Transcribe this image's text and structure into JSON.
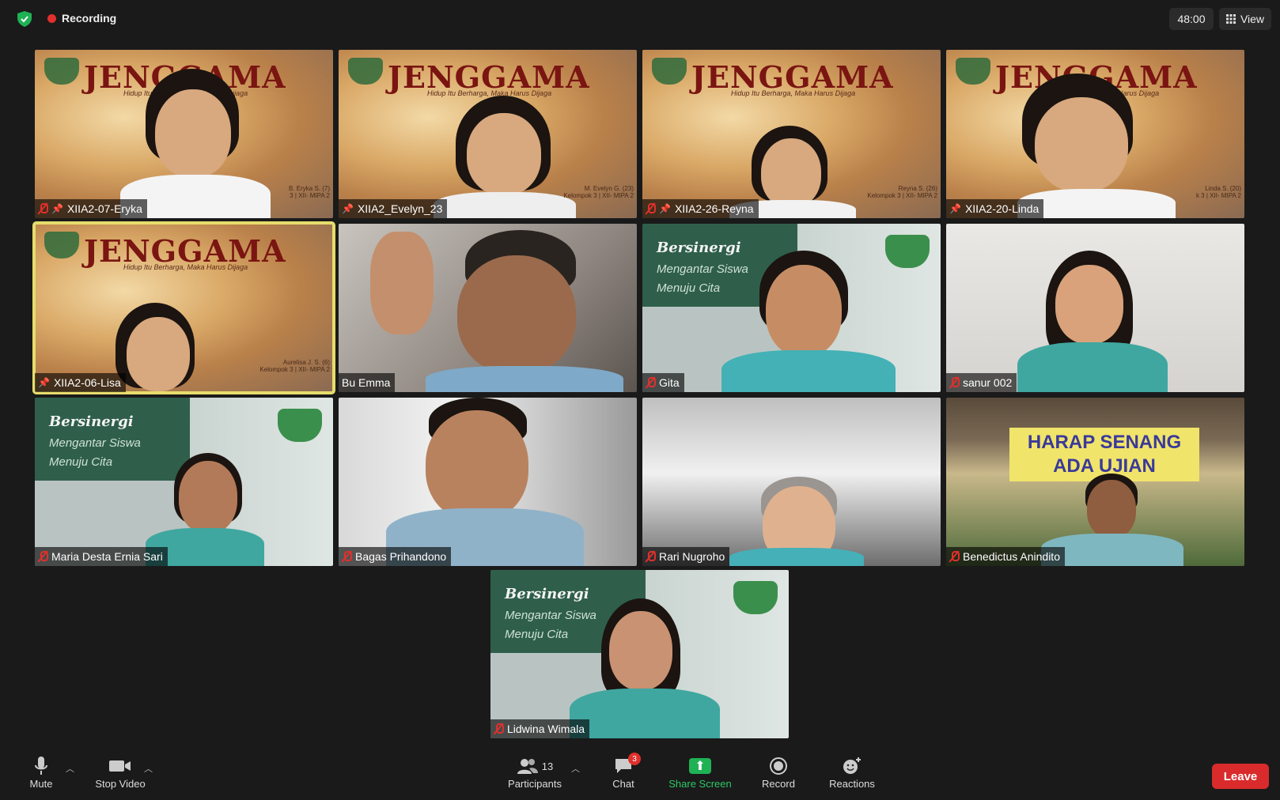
{
  "top": {
    "recording_label": "Recording",
    "timer": "48:00",
    "view_label": "View"
  },
  "jenggama": {
    "title": "JENGGAMA",
    "subtitle": "Hidup Itu Berharga, Maka Harus Dijaga"
  },
  "bersinergi": {
    "title": "Bersinergi",
    "line1": "Mengantar Siswa",
    "line2": "Menuju Cita"
  },
  "banner": {
    "line1": "HARAP SENANG",
    "line2": "ADA UJIAN"
  },
  "tiles": [
    {
      "name": "XIIA2-07-Eryka",
      "note1": "B. Eryka S. (7)",
      "note2": "3 | XII- MIPA 2"
    },
    {
      "name": "XIIA2_Evelyn_23",
      "note1": "M. Evelyn G. (23)",
      "note2": "Kelompok 3 | XII- MIPA 2"
    },
    {
      "name": "XIIA2-26-Reyna",
      "note1": "Reyna S. (26)",
      "note2": "Kelompok 3 | XII- MIPA 2"
    },
    {
      "name": "XIIA2-20-Linda",
      "note1": "Linda S. (20)",
      "note2": "k 3 | XII- MIPA 2"
    },
    {
      "name": "XIIA2-06-Lisa",
      "note1": "Aurelisa J. S. (6)",
      "note2": "Kelompok 3 | XII- MIPA 2"
    },
    {
      "name": "Bu Emma"
    },
    {
      "name": "Gita"
    },
    {
      "name": "sanur 002"
    },
    {
      "name": "Maria Desta Ernia Sari"
    },
    {
      "name": "Bagas Prihandono"
    },
    {
      "name": "Rari Nugroho"
    },
    {
      "name": "Benedictus Anindito"
    },
    {
      "name": "Lidwina Wimala"
    }
  ],
  "toolbar": {
    "mute": "Mute",
    "stop_video": "Stop Video",
    "participants": "Participants",
    "participants_count": "13",
    "chat": "Chat",
    "chat_badge": "3",
    "share": "Share Screen",
    "record": "Record",
    "reactions": "Reactions",
    "leave": "Leave"
  },
  "colors": {
    "accent_green": "#1fb255",
    "leave_red": "#d92b2b",
    "active_border": "#e6dd6c",
    "record_red": "#e0302c"
  }
}
